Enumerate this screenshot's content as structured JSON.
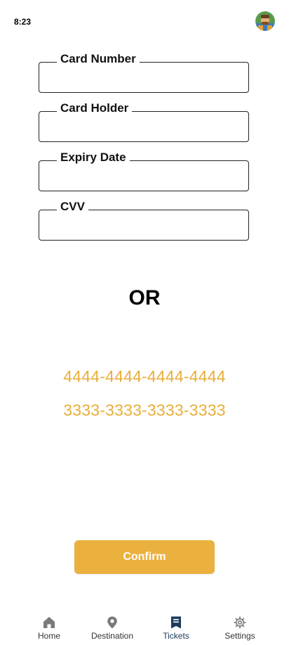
{
  "status_bar": {
    "time": "8:23"
  },
  "form": {
    "fields": [
      {
        "label": "Card Number",
        "value": ""
      },
      {
        "label": "Card Holder",
        "value": ""
      },
      {
        "label": "Expiry Date",
        "value": ""
      },
      {
        "label": "CVV",
        "value": ""
      }
    ]
  },
  "divider_text": "OR",
  "saved_cards": [
    "4444-4444-4444-4444",
    "3333-3333-3333-3333"
  ],
  "confirm_label": "Confirm",
  "bottom_nav": {
    "items": [
      {
        "label": "Home",
        "icon": "home-icon"
      },
      {
        "label": "Destination",
        "icon": "location-pin-icon"
      },
      {
        "label": "Tickets",
        "icon": "ticket-icon",
        "active": true
      },
      {
        "label": "Settings",
        "icon": "gear-icon"
      }
    ]
  },
  "colors": {
    "accent": "#ebb13f",
    "link": "#e9ae3b",
    "nav_active": "#1c3a5c",
    "nav_inactive": "#7a7a7a"
  }
}
